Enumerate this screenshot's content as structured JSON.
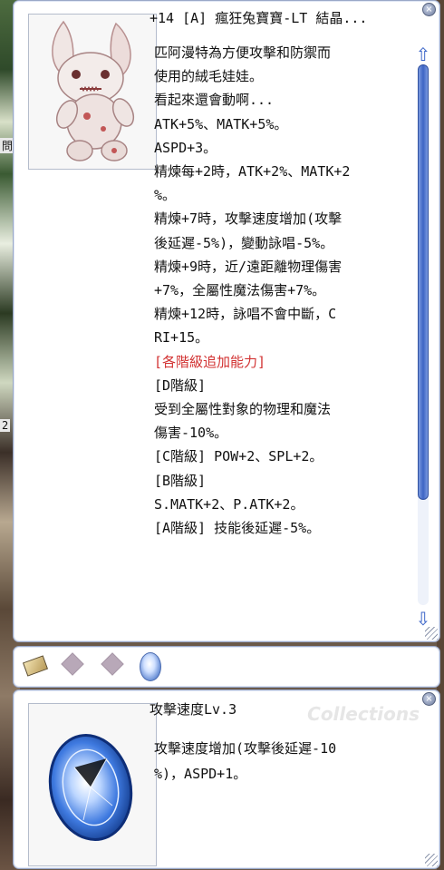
{
  "item": {
    "title": "+14 [A] 瘋狂兔寶寶-LT 結晶...",
    "description_lines": [
      {
        "text": "匹阿漫特為方便攻擊和防禦而",
        "color": "#111111"
      },
      {
        "text": "使用的絨毛娃娃。",
        "color": "#111111"
      },
      {
        "text": "看起來還會動啊...",
        "color": "#111111"
      },
      {
        "text": "ATK+5%、MATK+5%。",
        "color": "#111111"
      },
      {
        "text": "ASPD+3。",
        "color": "#111111"
      },
      {
        "text": "精煉每+2時，ATK+2%、MATK+2",
        "color": "#111111"
      },
      {
        "text": "%。",
        "color": "#111111"
      },
      {
        "text": "精煉+7時，攻擊速度增加(攻擊",
        "color": "#111111"
      },
      {
        "text": "後延遲-5%)，變動詠唱-5%。",
        "color": "#111111"
      },
      {
        "text": "精煉+9時，近/遠距離物理傷害",
        "color": "#111111"
      },
      {
        "text": "+7%，全屬性魔法傷害+7%。",
        "color": "#111111"
      },
      {
        "text": "精煉+12時，詠唱不會中斷，C",
        "color": "#111111"
      },
      {
        "text": "RI+15。",
        "color": "#111111"
      },
      {
        "text": "[各階級追加能力]",
        "color": "#d23232"
      },
      {
        "text": "[D階級]",
        "color": "#111111"
      },
      {
        "text": " 受到全屬性對象的物理和魔法",
        "color": "#111111"
      },
      {
        "text": "傷害-10%。",
        "color": "#111111"
      },
      {
        "text": "[C階級] POW+2、SPL+2。",
        "color": "#111111"
      },
      {
        "text": "[B階級]",
        "color": "#111111"
      },
      {
        "text": " S.MATK+2、P.ATK+2。",
        "color": "#111111"
      },
      {
        "text": "[A階級] 技能後延遲-5%。",
        "color": "#111111"
      }
    ],
    "image_icon": "rabbit-doll-icon",
    "scroll_position": 0.0
  },
  "slots": [
    {
      "type": "card",
      "icon": "card-slot-icon"
    },
    {
      "type": "empty",
      "icon": "empty-slot-icon"
    },
    {
      "type": "empty",
      "icon": "empty-slot-icon"
    },
    {
      "type": "gem",
      "icon": "blue-gem-icon"
    }
  ],
  "card": {
    "title": "攻擊速度Lv.3",
    "watermark": "Collections",
    "description_lines": [
      "攻擊速度增加(攻擊後延遲-10",
      "%)，ASPD+1。"
    ],
    "image_icon": "blue-gem-icon"
  },
  "background": {
    "tags": [
      "問",
      "2"
    ]
  },
  "colors": {
    "accent": "#3d64c4",
    "highlight": "#d23232",
    "panel_border": "#9aa8c8"
  }
}
